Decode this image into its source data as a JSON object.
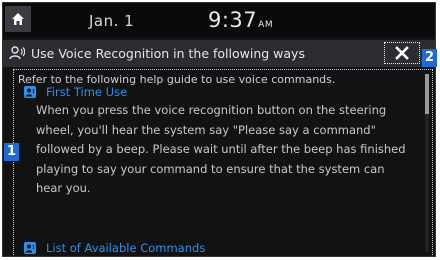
{
  "status_bar": {
    "home_icon": "home-icon",
    "date": "Jan. 1",
    "time": "9:37",
    "ampm": "AM"
  },
  "dialog": {
    "title": "Use Voice Recognition in the following ways",
    "title_icon": "voice-recognition-icon",
    "close_icon": "close-icon",
    "intro": "Refer to the following help guide to use voice commands.",
    "sections": [
      {
        "heading": "First Time Use",
        "icon": "voice-recognition-icon",
        "body": "When you press the voice recognition button on the steering wheel, you'll hear the system say \"Please say a command\" followed by a beep. Please wait until after the beep has finished playing to say your command to ensure that the system can hear you."
      },
      {
        "heading": "List of Available Commands",
        "icon": "voice-recognition-icon"
      }
    ]
  },
  "callouts": [
    "1",
    "2"
  ],
  "colors": {
    "accent": "#2e8fe8",
    "callout": "#1f6bd4",
    "background": "#111214"
  }
}
